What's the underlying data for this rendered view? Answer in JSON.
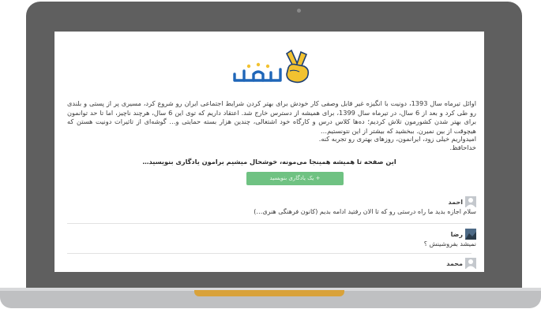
{
  "page": {
    "paragraph1": "اوائل تیرماه سال 1393، دونیت با انگیزه غیر قابل وصفی کار خودش برای بهتر کردن شرایط اجتماعی ایران رو شروع کرد، مسیری پر از پستی و بلندی رو طی کرد و بعد از 6 سال، در تیرماه سال 1399، برای همیشه از دسترس خارج شد. اعتقاد داریم که توی این 6 سال، هرچند ناچیز، اما تا حد توانمون برای بهتر شدن کشورمون تلاش کردیم؛ ده‌ها کلاس درس و کارگاه خود اشتغالی، چندین هزار بسته حمایتی و… گوشه‌ای از تاثیرات دونیت هستن که هیچوقت از بین نمیرن. ببخشید که بیشتر از این نتونستیم…",
    "wish_line1": "امیدواریم خیلی زود، ایرانمون، روزهای بهتری رو تجربه کنه.",
    "wish_line2": "خداحافظ.",
    "headline": "این صفحه تا همیشه همینجا می‌مونه، خوشحال میشیم برامون یادگاری بنویسید…",
    "cta_label": "+ یک یادگاری بنویسید"
  },
  "comments": [
    {
      "name": "احمد",
      "text": "سلام اجازه بدید ما راه درستی رو که تا الان رفتید ادامه بدیم (کانون فرهنگی هنری…)"
    },
    {
      "name": "رضا",
      "text": "نمیشد بفروشینش ؟"
    },
    {
      "name": "محمد",
      "text": ""
    }
  ],
  "colors": {
    "accent_green": "#6fc282",
    "logo_blue": "#1f66b8",
    "logo_yellow": "#f2c230",
    "laptop_frame": "#5f5f5f"
  }
}
